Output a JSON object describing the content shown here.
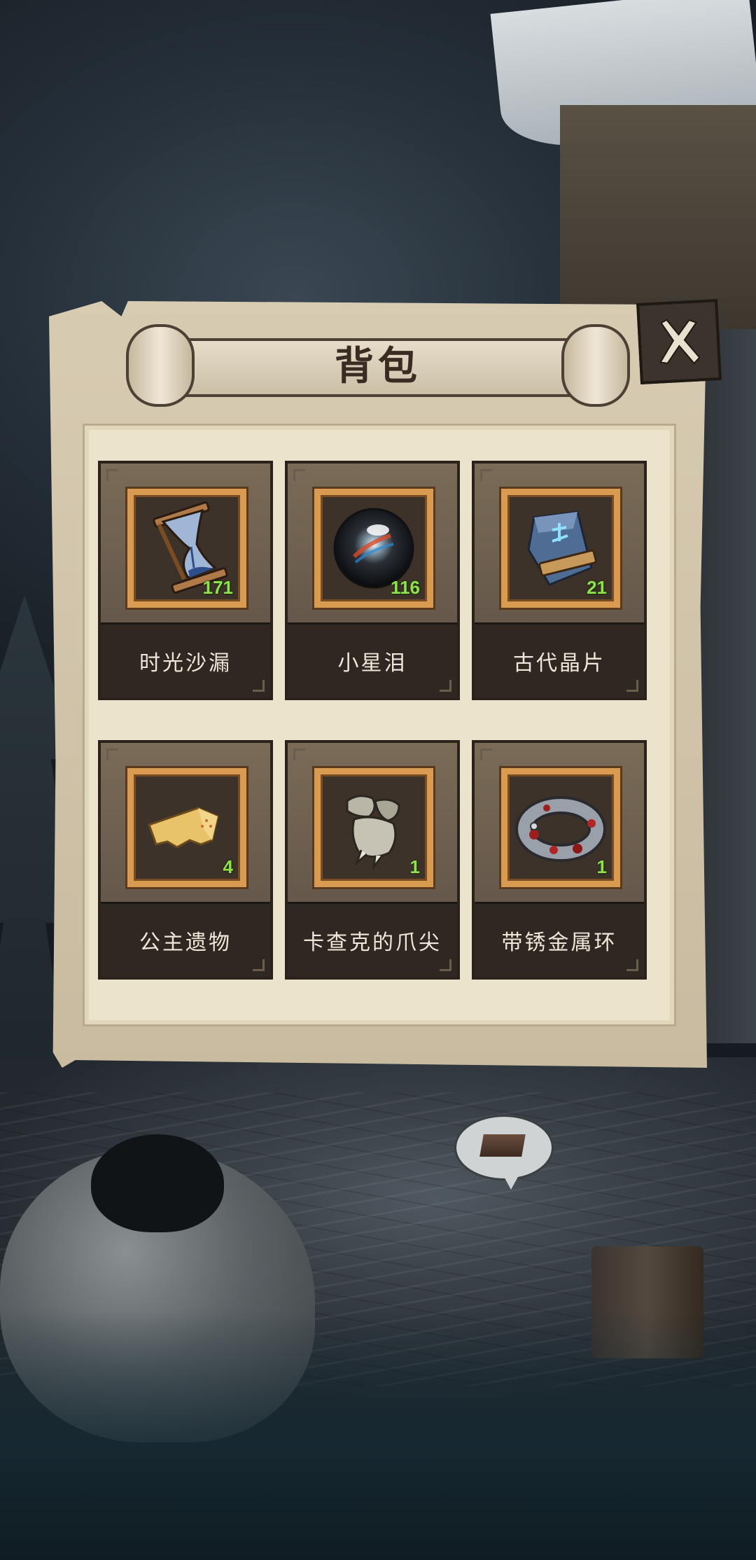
{
  "backpack": {
    "title": "背包",
    "items": [
      {
        "name": "时光沙漏",
        "count": "171",
        "icon": "hourglass-icon"
      },
      {
        "name": "小星泪",
        "count": "116",
        "icon": "star-tear-orb-icon"
      },
      {
        "name": "古代晶片",
        "count": "21",
        "icon": "ancient-crystal-shard-icon"
      },
      {
        "name": "公主遗物",
        "count": "4",
        "icon": "princess-relic-icon"
      },
      {
        "name": "卡查克的爪尖",
        "count": "1",
        "icon": "claw-tip-icon"
      },
      {
        "name": "带锈金属环",
        "count": "1",
        "icon": "rusty-metal-ring-icon"
      }
    ]
  },
  "colors": {
    "count_text": "#8ee24c",
    "frame_gold": "#d99a52",
    "card_bg": "#6f614f",
    "label_bg": "#2f2822",
    "panel_bg": "#ece3cc"
  }
}
